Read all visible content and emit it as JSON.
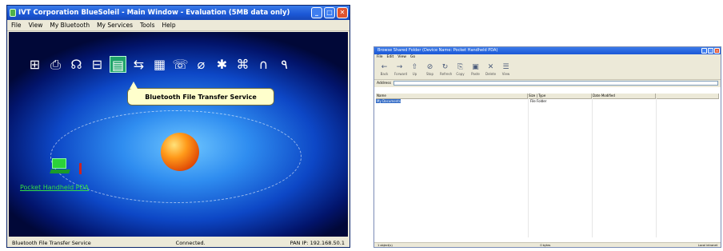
{
  "main_window": {
    "title": "IVT Corporation BlueSoleil - Main Window - Evaluation (5MB data only)",
    "menu": [
      "File",
      "View",
      "My Bluetooth",
      "My Services",
      "Tools",
      "Help"
    ],
    "service_icons": [
      "network-icon",
      "printer-icon",
      "headset-icon",
      "lan-icon",
      "file-transfer-icon",
      "sync-icon",
      "dialup-icon",
      "fax-icon",
      "pan-icon",
      "serial-icon",
      "bip-icon",
      "audio-icon",
      "hid-icon"
    ],
    "selected_service_index": 4,
    "tooltip": "Bluetooth File Transfer Service",
    "device_label": "Pocket Handheld PDA",
    "status": {
      "left": "Bluetooth File Transfer Service",
      "center": "Connected.",
      "right": "PAN IP: 192.168.50.1"
    }
  },
  "ftp_window": {
    "title": "Browse Shared Folder (Device Name: Pocket Handheld PDA)",
    "menu": [
      "File",
      "Edit",
      "View",
      "Go"
    ],
    "toolbar": [
      "Back",
      "Forward",
      "Up",
      "Stop",
      "Refresh",
      "Copy",
      "Paste",
      "Delete",
      "View"
    ],
    "address_label": "Address",
    "address_value": "",
    "columns": [
      "Name",
      "Size | Type",
      "Date Modified"
    ],
    "rows": [
      {
        "name": "My Documents",
        "type": "File Folder",
        "date": ""
      }
    ],
    "status_left": "1 object(s)",
    "status_center": "0 bytes",
    "status_right": "Local intranet"
  }
}
